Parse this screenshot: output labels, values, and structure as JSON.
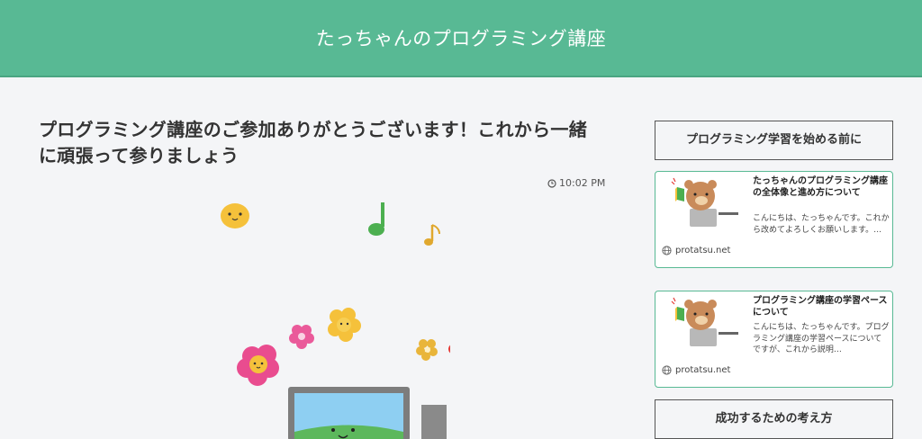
{
  "site": {
    "title": "たっちゃんのプログラミング講座"
  },
  "post": {
    "title": "プログラミング講座のご参加ありがとうございます！これから一緒に頑張って参りましょう",
    "time": "10:02 PM"
  },
  "sidebar": {
    "widgets": [
      {
        "heading": "プログラミング学習を始める前に"
      },
      {
        "heading": "成功するための考え方"
      }
    ],
    "cards": [
      {
        "title": "たっちゃんのプログラミング講座の全体像と進め方について",
        "excerpt": "こんにちは、たっちゃんです。これから改めてよろしくお願いします。…",
        "domain": "protatsu.net"
      },
      {
        "title": "プログラミング講座の学習ペースについて",
        "excerpt": "こんにちは、たっちゃんです。プログラミング講座の学習ペースについてですが、これから説明…",
        "domain": "protatsu.net"
      }
    ]
  },
  "colors": {
    "header": "#58b994",
    "card_border": "#58b994",
    "background": "#f4f5f7"
  }
}
